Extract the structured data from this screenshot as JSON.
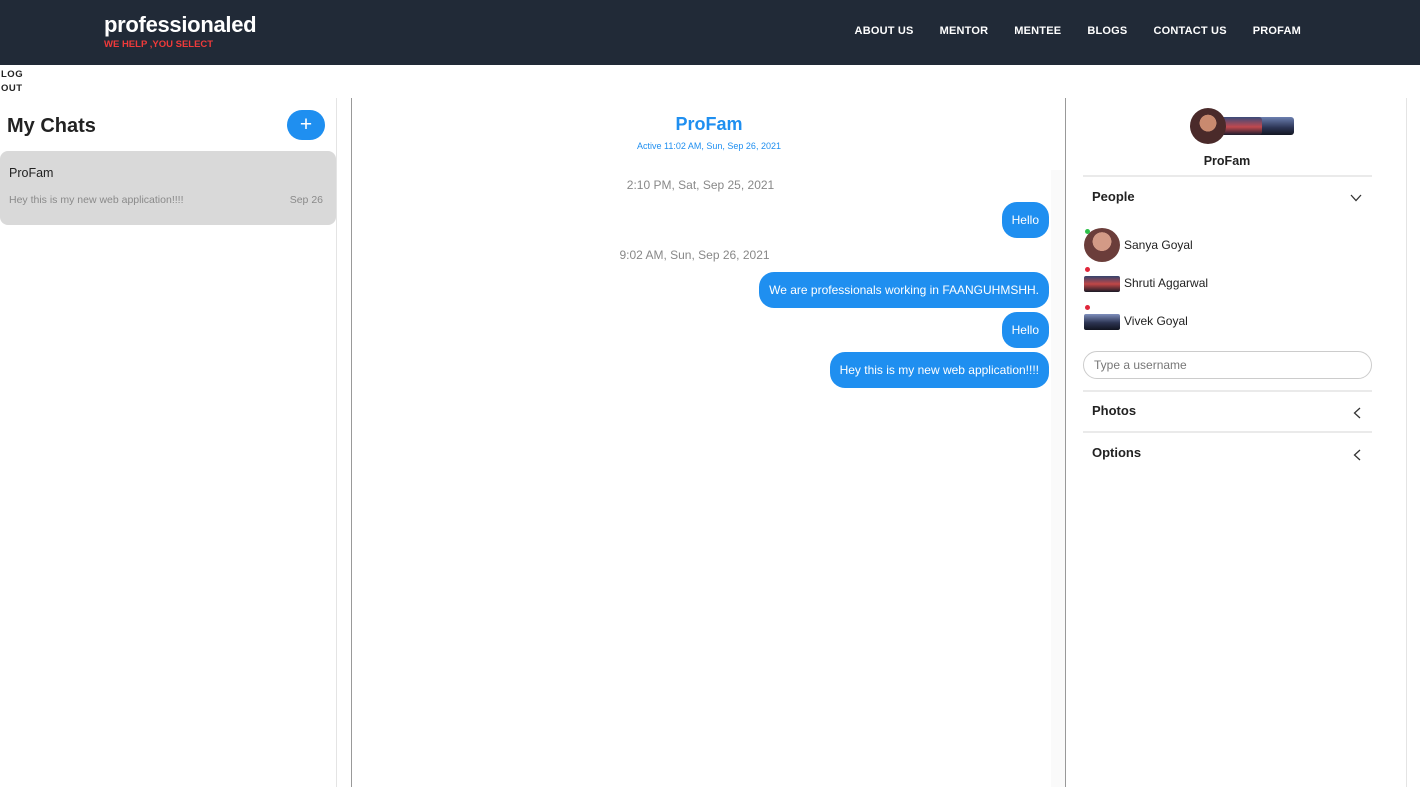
{
  "brand": {
    "name": "professionaled",
    "tagline": "WE HELP ,YOU SELECT"
  },
  "nav": {
    "links": [
      "ABOUT US",
      "MENTOR",
      "MENTEE",
      "BLOGS",
      "CONTACT US",
      "PROFAM"
    ],
    "logout": "LOG OUT"
  },
  "chats": {
    "title": "My Chats",
    "new_button": "+",
    "list": [
      {
        "name": "ProFam",
        "preview": "Hey this is my new web application!!!!",
        "date": "Sep 26"
      }
    ]
  },
  "feed": {
    "title": "ProFam",
    "active": "Active 11:02 AM, Sun, Sep 26, 2021",
    "timestamps": [
      "2:10 PM, Sat, Sep 25, 2021",
      "9:02 AM, Sun, Sep 26, 2021"
    ],
    "messages": [
      "Hello",
      "We are professionals working in FAANGUHMSHH.",
      "Hello",
      "Hey this is my new web application!!!!"
    ]
  },
  "settings": {
    "title": "ProFam",
    "sections": {
      "people": "People",
      "photos": "Photos",
      "options": "Options"
    },
    "people": [
      {
        "name": "Sanya Goyal",
        "status": "online"
      },
      {
        "name": "Shruti Aggarwal",
        "status": "offline"
      },
      {
        "name": "Vivek Goyal",
        "status": "offline"
      }
    ],
    "username_placeholder": "Type a username"
  },
  "colors": {
    "navbar": "#212a37",
    "accent": "#1f8ff0",
    "tagline": "#f03a3a",
    "online": "#2ec04a",
    "offline": "#e0263a"
  }
}
